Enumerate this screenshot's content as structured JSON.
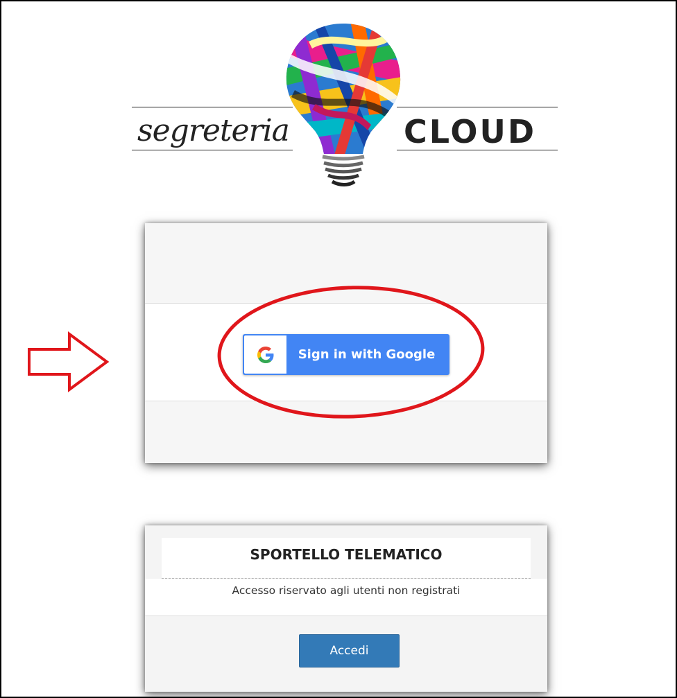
{
  "logo": {
    "word_left": "segreteria",
    "word_right": "CLOUD",
    "bulb_icon": "lightbulb-icon"
  },
  "login_card": {
    "google_button": {
      "label": "Sign in with Google",
      "icon": "google-g-icon",
      "color": "#4285f4"
    }
  },
  "sportello_card": {
    "title": "SPORTELLO TELEMATICO",
    "subtitle": "Accesso riservato agli utenti non registrati",
    "button_label": "Accedi",
    "button_color": "#337ab7"
  },
  "annotations": {
    "arrow_icon": "right-arrow-outline-icon",
    "highlight": "red-ellipse",
    "color": "#e0161b"
  }
}
